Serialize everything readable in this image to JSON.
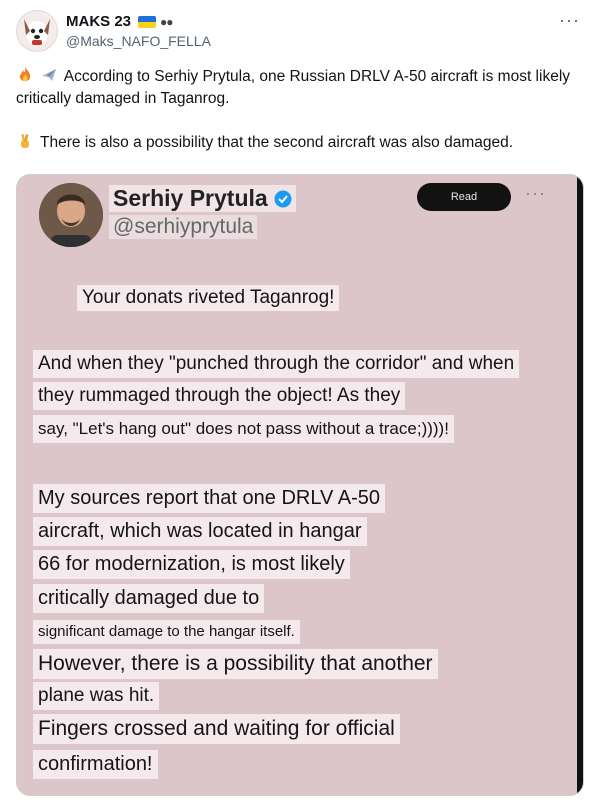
{
  "author": {
    "display_name": "MAKS 23",
    "handle": "@Maks_NAFO_FELLA",
    "avatar_icon": "cartoon-dog-avatar",
    "flag_colors": [
      "#1f6fd8",
      "#f6d21b"
    ]
  },
  "tweet": {
    "line1": "According to Serhiy Prytula, one Russian DRLV A-50 aircraft is most likely critically damaged in Taganrog.",
    "line2": "There is also a possibility that the second aircraft was also damaged.",
    "emoji1": "fire-icon",
    "emoji2": "airplane-icon",
    "emoji3": "crossed-fingers-icon"
  },
  "media": {
    "name": "Serhiy Prytula",
    "handle": "@serhiyprytula",
    "read_label": "Read",
    "bg_color": "#ddc6c9",
    "lines": [
      "Your donats riveted Taganrog!",
      "And when they \"punched through the corridor\" and when",
      "they rummaged through the object! As they",
      "say, \"Let's hang out\" does not pass without a trace;))))!",
      "My sources report that one DRLV A-50",
      "aircraft, which was located in hangar",
      "66 for modernization, is most likely",
      "critically damaged due to",
      "significant damage to the hangar itself.",
      "However, there is a possibility that another",
      "plane was hit.",
      "Fingers crossed and waiting for official",
      "confirmation!"
    ]
  }
}
